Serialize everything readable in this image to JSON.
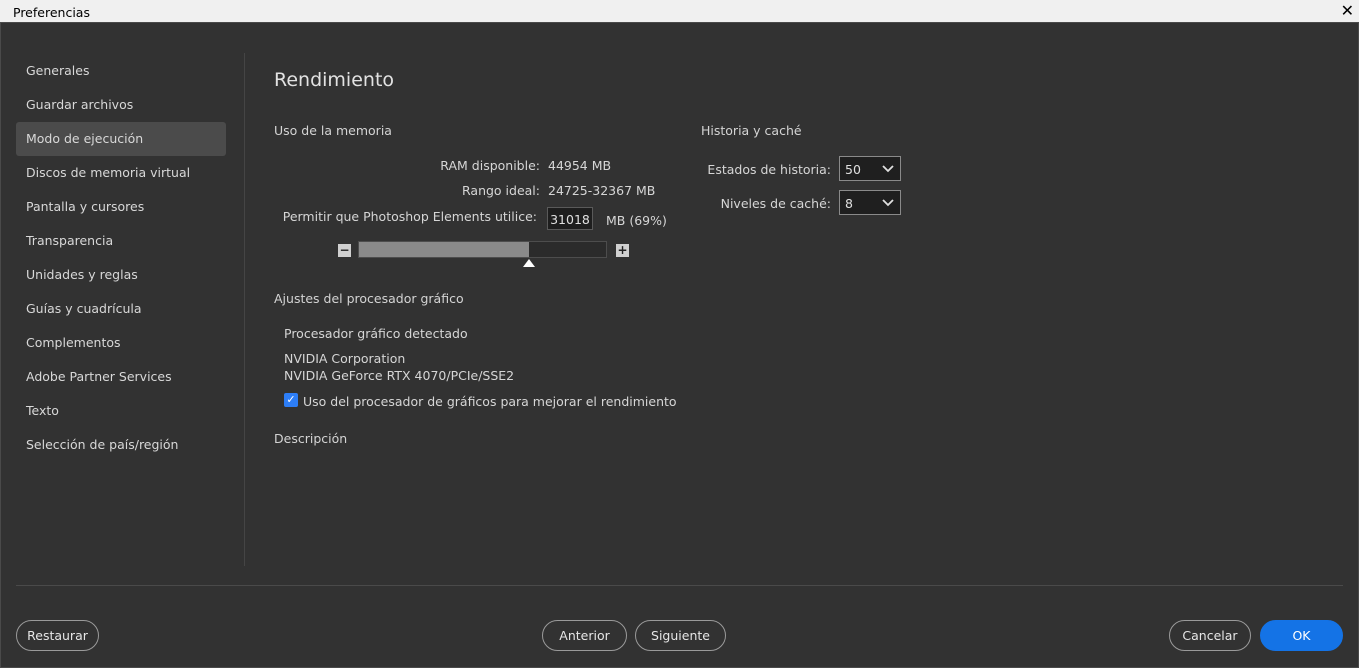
{
  "window": {
    "title": "Preferencias",
    "close_glyph": "✕"
  },
  "sidebar": {
    "items": [
      {
        "label": "Generales"
      },
      {
        "label": "Guardar archivos"
      },
      {
        "label": "Modo de ejecución"
      },
      {
        "label": "Discos de memoria virtual"
      },
      {
        "label": "Pantalla y cursores"
      },
      {
        "label": "Transparencia"
      },
      {
        "label": "Unidades y reglas"
      },
      {
        "label": "Guías y cuadrícula"
      },
      {
        "label": "Complementos"
      },
      {
        "label": "Adobe Partner Services"
      },
      {
        "label": "Texto"
      },
      {
        "label": "Selección de país/región"
      }
    ],
    "active_item": "Modo de ejecución"
  },
  "main": {
    "title": "Rendimiento",
    "memory": {
      "section_title": "Uso de la memoria",
      "ram_label": "RAM disponible:",
      "ram_value": "44954 MB",
      "ideal_label": "Rango ideal:",
      "ideal_value": "24725-32367 MB",
      "allow_label": "Permitir que Photoshop Elements utilice:",
      "allow_value": "31018",
      "allow_unit": "MB (69%)",
      "slider_percent": 69,
      "minus_glyph": "−",
      "plus_glyph": "+"
    },
    "history": {
      "section_title": "Historia y caché",
      "history_label": "Estados de historia:",
      "history_value": "50",
      "cache_label": "Niveles de caché:",
      "cache_value": "8"
    },
    "gpu": {
      "section_title": "Ajustes del procesador gráfico",
      "detected_label": "Procesador gráfico detectado",
      "vendor": "NVIDIA Corporation",
      "model": "NVIDIA GeForce RTX 4070/PCIe/SSE2",
      "use_gpu_label": "Uso del procesador de gráficos para mejorar el rendimiento",
      "use_gpu_checked": true
    },
    "description_title": "Descripción"
  },
  "footer": {
    "restore": "Restaurar",
    "previous": "Anterior",
    "next": "Siguiente",
    "cancel": "Cancelar",
    "ok": "OK"
  },
  "colors": {
    "background": "#323232",
    "accent": "#1473e6",
    "checkbox": "#2d7ef7"
  }
}
